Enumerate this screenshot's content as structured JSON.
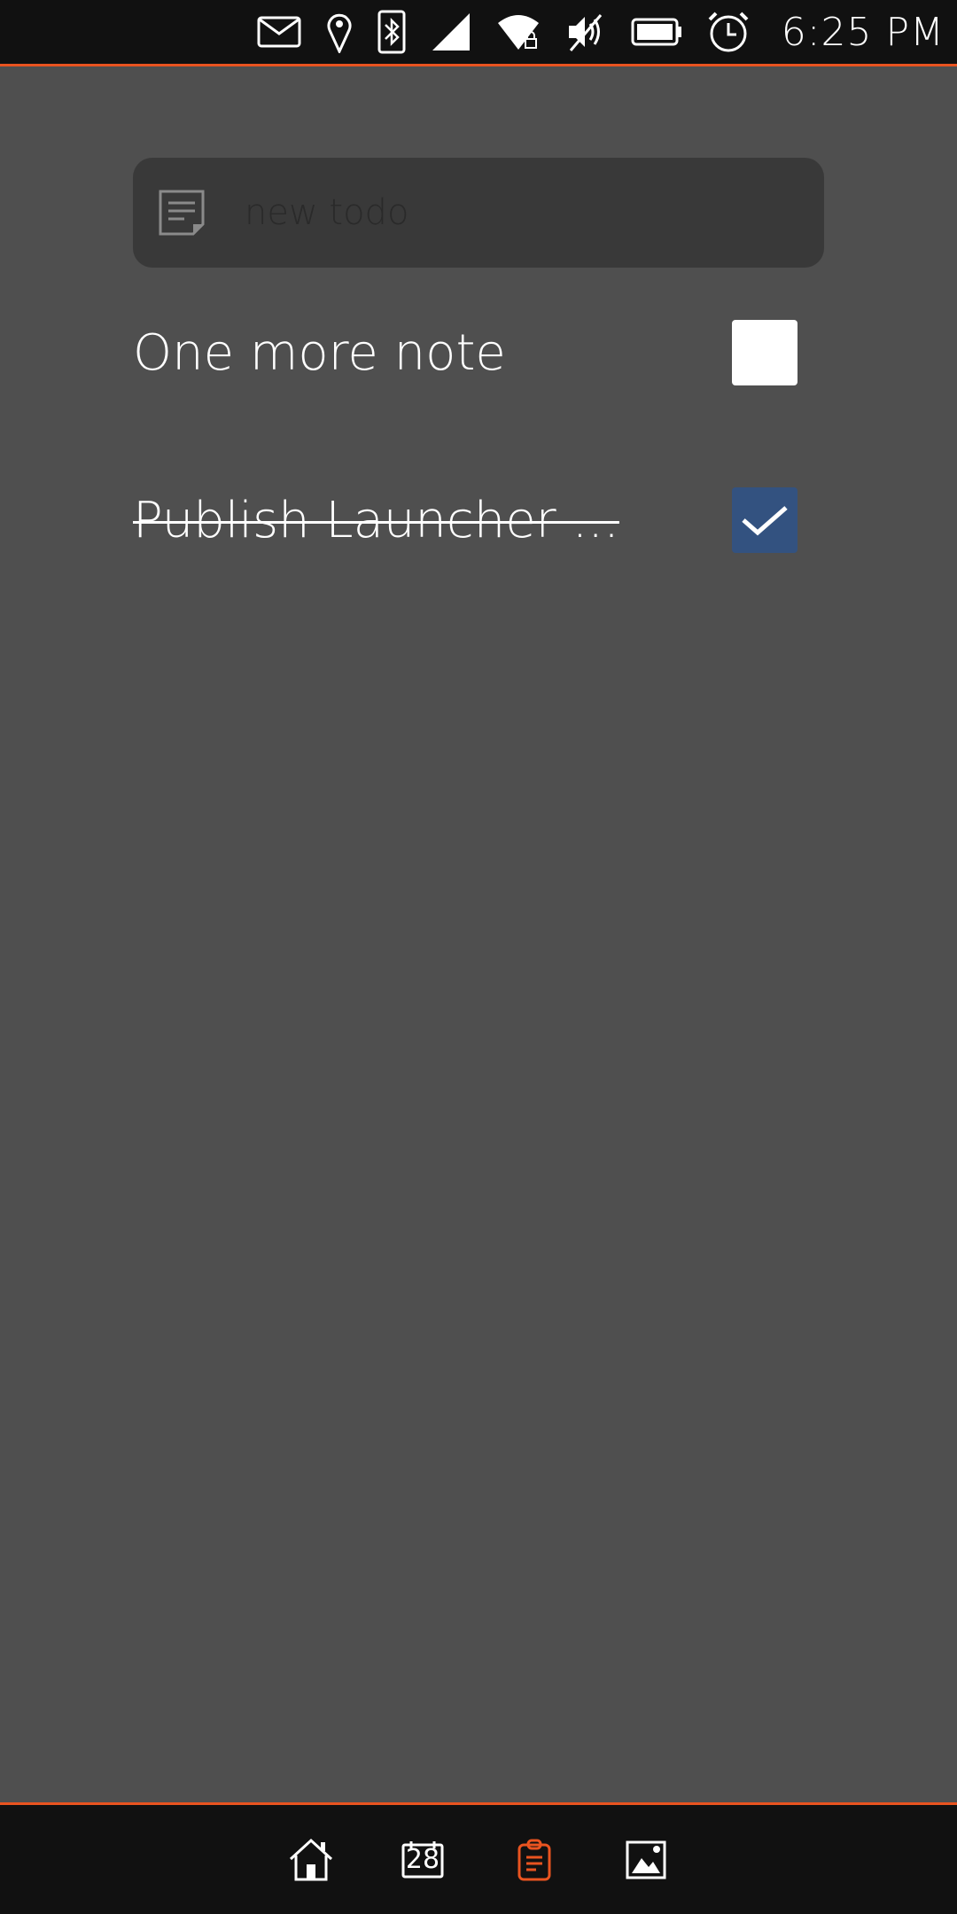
{
  "status_bar": {
    "icons": [
      "mail-icon",
      "location-icon",
      "bluetooth-icon",
      "signal-icon",
      "wifi-locked-icon",
      "muted-icon",
      "battery-icon",
      "alarm-icon"
    ],
    "time": "6:25 PM",
    "accent_color": "#e95420"
  },
  "new_todo": {
    "placeholder": "new todo",
    "value": ""
  },
  "todos": [
    {
      "text": "One more note",
      "done": false
    },
    {
      "text": "Publish Launcher ...",
      "done": true
    }
  ],
  "bottom_tabs": [
    {
      "name": "home",
      "icon": "home-icon",
      "active": false
    },
    {
      "name": "calendar",
      "icon": "calendar-icon",
      "label": "28",
      "active": false
    },
    {
      "name": "notes",
      "icon": "clipboard-icon",
      "active": true
    },
    {
      "name": "gallery",
      "icon": "image-icon",
      "active": false
    }
  ],
  "colors": {
    "background": "#4f4f4f",
    "checkbox_checked": "#335280",
    "active_tab": "#e95420"
  }
}
